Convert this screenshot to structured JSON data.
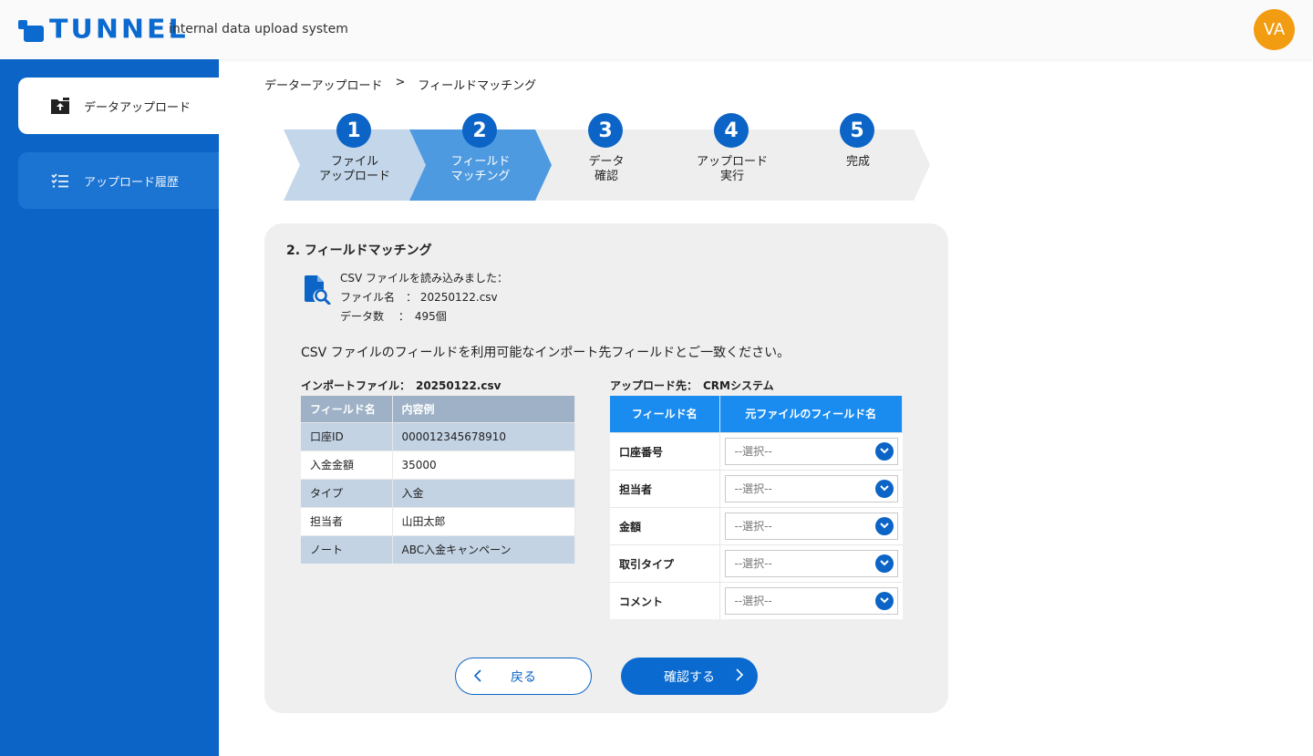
{
  "header": {
    "logo_text": "TUNNEL",
    "subtitle": "internal data upload system",
    "avatar_initials": "VA"
  },
  "sidebar": {
    "items": [
      {
        "label": "データアップロード",
        "icon": "folder-upload-icon",
        "active": true
      },
      {
        "label": "アップロード履歴",
        "icon": "list-icon",
        "active": false
      }
    ]
  },
  "breadcrumb": {
    "items": [
      "データーアップロード",
      "フィールドマッチング"
    ],
    "separator": ">"
  },
  "stepper": {
    "steps": [
      {
        "number": "1",
        "line1": "ファイル",
        "line2": "アップロード",
        "state": "done"
      },
      {
        "number": "2",
        "line1": "フィールド",
        "line2": "マッチング",
        "state": "current"
      },
      {
        "number": "3",
        "line1": "データ",
        "line2": "確認",
        "state": "todo"
      },
      {
        "number": "4",
        "line1": "アップロード",
        "line2": "実行",
        "state": "todo"
      },
      {
        "number": "5",
        "line1": "完成",
        "line2": "",
        "state": "todo"
      }
    ]
  },
  "panel": {
    "title": "2. フィールドマッチング",
    "file_info": {
      "loaded": "CSV ファイルを読み込みました：",
      "filename_line": "ファイル名　：  20250122.csv",
      "count_line": "データ数　 ：　495個"
    },
    "instruction": "CSV ファイルのフィールドを利用可能なインポート先フィールドとご一致ください。"
  },
  "import_table": {
    "caption": "インポートファイル：　20250122.csv",
    "headers": [
      "フィールド名",
      "内容例"
    ],
    "rows": [
      [
        "口座ID",
        "000012345678910"
      ],
      [
        "入金金額",
        "35000"
      ],
      [
        "タイプ",
        "入金"
      ],
      [
        "担当者",
        "山田太郎"
      ],
      [
        "ノート",
        "ABC入金キャンペーン"
      ]
    ]
  },
  "mapping_table": {
    "caption": "アップロード先：　CRMシステム",
    "headers": [
      "フィールド名",
      "元ファイルのフィールド名"
    ],
    "rows": [
      {
        "field": "口座番号",
        "selected": "--選択--"
      },
      {
        "field": "担当者",
        "selected": "--選択--"
      },
      {
        "field": "金額",
        "selected": "--選択--"
      },
      {
        "field": "取引タイプ",
        "selected": "--選択--"
      },
      {
        "field": "コメント",
        "selected": "--選択--"
      }
    ]
  },
  "buttons": {
    "back": "戻る",
    "confirm": "確認する"
  },
  "colors": {
    "primary": "#0b64c6",
    "accent": "#1a8cf0",
    "avatar": "#f29c11",
    "step_done": "#c3d6ea",
    "step_current": "#4e9ae0",
    "step_todo": "#eeeeee"
  }
}
